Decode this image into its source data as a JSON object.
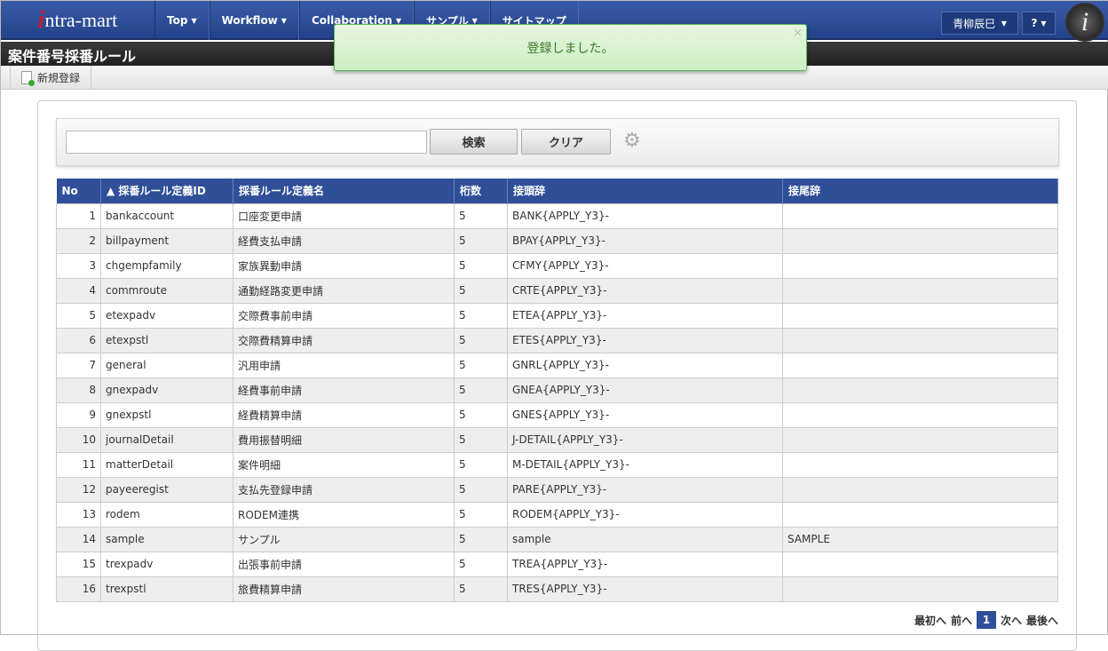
{
  "nav": {
    "logo": "intra-mart",
    "menu": [
      "Top",
      "Workflow",
      "Collaboration",
      "サンプル",
      "サイトマップ"
    ],
    "user": "青柳辰巳",
    "help": "?"
  },
  "page_title": "案件番号採番ルール",
  "toolbar": {
    "new": "新規登録"
  },
  "notice": {
    "text": "登録しました。",
    "close": "×"
  },
  "search": {
    "value": "",
    "search_label": "検索",
    "clear_label": "クリア"
  },
  "table": {
    "headers": [
      "No",
      "▲ 採番ルール定義ID",
      "採番ルール定義名",
      "桁数",
      "接頭辞",
      "接尾辞"
    ],
    "rows": [
      [
        "1",
        "bankaccount",
        "口座変更申請",
        "5",
        "BANK{APPLY_Y3}-",
        ""
      ],
      [
        "2",
        "billpayment",
        "経費支払申請",
        "5",
        "BPAY{APPLY_Y3}-",
        ""
      ],
      [
        "3",
        "chgempfamily",
        "家族異動申請",
        "5",
        "CFMY{APPLY_Y3}-",
        ""
      ],
      [
        "4",
        "commroute",
        "通勤経路変更申請",
        "5",
        "CRTE{APPLY_Y3}-",
        ""
      ],
      [
        "5",
        "etexpadv",
        "交際費事前申請",
        "5",
        "ETEA{APPLY_Y3}-",
        ""
      ],
      [
        "6",
        "etexpstl",
        "交際費精算申請",
        "5",
        "ETES{APPLY_Y3}-",
        ""
      ],
      [
        "7",
        "general",
        "汎用申請",
        "5",
        "GNRL{APPLY_Y3}-",
        ""
      ],
      [
        "8",
        "gnexpadv",
        "経費事前申請",
        "5",
        "GNEA{APPLY_Y3}-",
        ""
      ],
      [
        "9",
        "gnexpstl",
        "経費精算申請",
        "5",
        "GNES{APPLY_Y3}-",
        ""
      ],
      [
        "10",
        "journalDetail",
        "費用振替明細",
        "5",
        "J-DETAIL{APPLY_Y3}-",
        ""
      ],
      [
        "11",
        "matterDetail",
        "案件明細",
        "5",
        "M-DETAIL{APPLY_Y3}-",
        ""
      ],
      [
        "12",
        "payeeregist",
        "支払先登録申請",
        "5",
        "PARE{APPLY_Y3}-",
        ""
      ],
      [
        "13",
        "rodem",
        "RODEM連携",
        "5",
        "RODEM{APPLY_Y3}-",
        ""
      ],
      [
        "14",
        "sample",
        "サンプル",
        "5",
        "sample",
        "SAMPLE"
      ],
      [
        "15",
        "trexpadv",
        "出張事前申請",
        "5",
        "TREA{APPLY_Y3}-",
        ""
      ],
      [
        "16",
        "trexpstl",
        "旅費精算申請",
        "5",
        "TRES{APPLY_Y3}-",
        ""
      ]
    ]
  },
  "pager": {
    "first": "最初へ",
    "prev": "前へ",
    "current": "1",
    "next": "次へ",
    "last": "最後へ"
  }
}
